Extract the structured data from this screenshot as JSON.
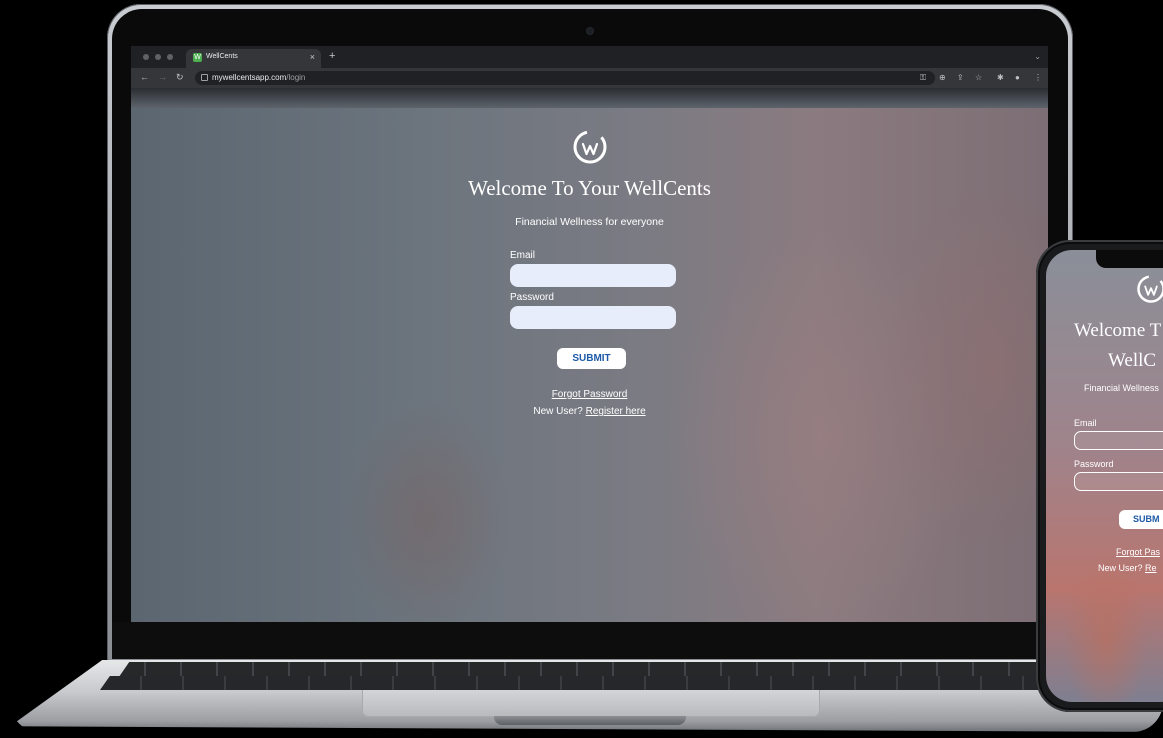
{
  "browser": {
    "tab_title": "WellCents",
    "favicon_letter": "W",
    "url_host": "mywellcentsapp.com",
    "url_path": "/login",
    "new_tab_icon": "plus-icon",
    "tab_close_icon": "close-icon"
  },
  "login": {
    "welcome_title": "Welcome To Your WellCents",
    "tagline": "Financial Wellness for everyone",
    "email_label": "Email",
    "email_value": "",
    "password_label": "Password",
    "password_value": "",
    "submit_label": "SUBMIT",
    "forgot_label": "Forgot Password",
    "new_user_prefix": "New User?",
    "register_label": "Register here"
  },
  "phone": {
    "title_line1": "Welcome T",
    "title_line2": "WellC",
    "tagline": "Financial Wellness",
    "email_label": "Email",
    "password_label": "Password",
    "submit_label": "SUBM",
    "forgot_label": "Forgot Pas",
    "new_user_prefix": "New User?",
    "register_label": "Re"
  },
  "colors": {
    "accent": "#1e5aa8",
    "input_fill": "#e8edfb",
    "browser_dark": "#202124"
  }
}
